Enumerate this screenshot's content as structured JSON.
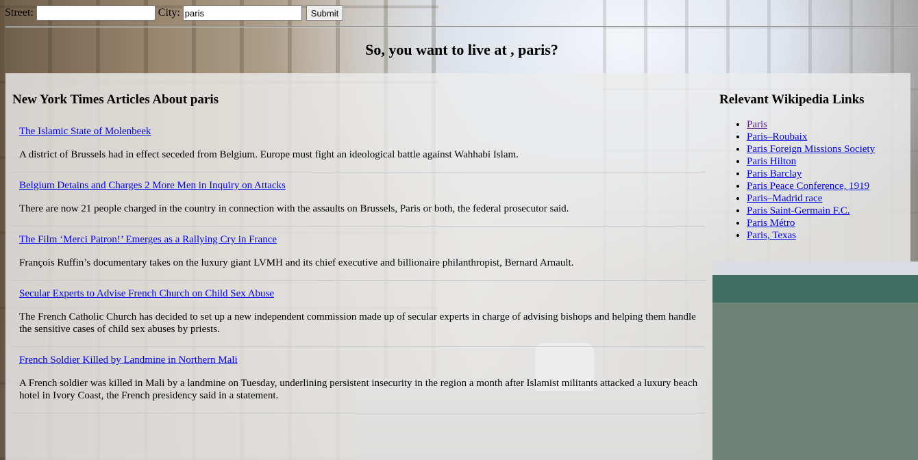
{
  "search": {
    "street_label": "Street:",
    "street_value": "",
    "city_label": "City:",
    "city_value": "paris",
    "submit_label": "Submit"
  },
  "page_title": "So, you want to live at , paris?",
  "nyt": {
    "heading": "New York Times Articles About paris",
    "articles": [
      {
        "title": "The Islamic State of Molenbeek",
        "summary": "A district of Brussels had in effect seceded from Belgium. Europe must fight an ideological battle against Wahhabi Islam."
      },
      {
        "title": "Belgium Detains and Charges 2 More Men in Inquiry on Attacks",
        "summary": "There are now 21 people charged in the country in connection with the assaults on Brussels, Paris or both, the federal prosecutor said."
      },
      {
        "title": "The Film ‘Merci Patron!’ Emerges as a Rallying Cry in France",
        "summary": "François Ruffin’s documentary takes on the luxury giant LVMH and its chief executive and billionaire philanthropist, Bernard Arnault."
      },
      {
        "title": "Secular Experts to Advise French Church on Child Sex Abuse",
        "summary": "The French Catholic Church has decided to set up a new independent commission made up of secular experts in charge of advising bishops and helping them handle the sensitive cases of child sex abuses by priests."
      },
      {
        "title": "French Soldier Killed by Landmine in Northern Mali",
        "summary": "A French soldier was killed in Mali by a landmine on Tuesday, underlining persistent insecurity in the region a month after Islamist militants attacked a luxury beach hotel in Ivory Coast, the French presidency said in a statement."
      }
    ]
  },
  "wiki": {
    "heading": "Relevant Wikipedia Links",
    "links": [
      {
        "label": "Paris",
        "visited": true
      },
      {
        "label": "Paris–Roubaix",
        "visited": false
      },
      {
        "label": "Paris Foreign Missions Society",
        "visited": false
      },
      {
        "label": "Paris Hilton",
        "visited": false
      },
      {
        "label": "Paris Barclay",
        "visited": false
      },
      {
        "label": "Paris Peace Conference, 1919",
        "visited": false
      },
      {
        "label": "Paris–Madrid race",
        "visited": false
      },
      {
        "label": "Paris Saint-Germain F.C.",
        "visited": false
      },
      {
        "label": "Paris Métro",
        "visited": false
      },
      {
        "label": "Paris, Texas",
        "visited": false
      }
    ]
  },
  "colors": {
    "link": "#0000ee",
    "visited_link": "#551a8b",
    "panel_bg": "#ececec"
  }
}
